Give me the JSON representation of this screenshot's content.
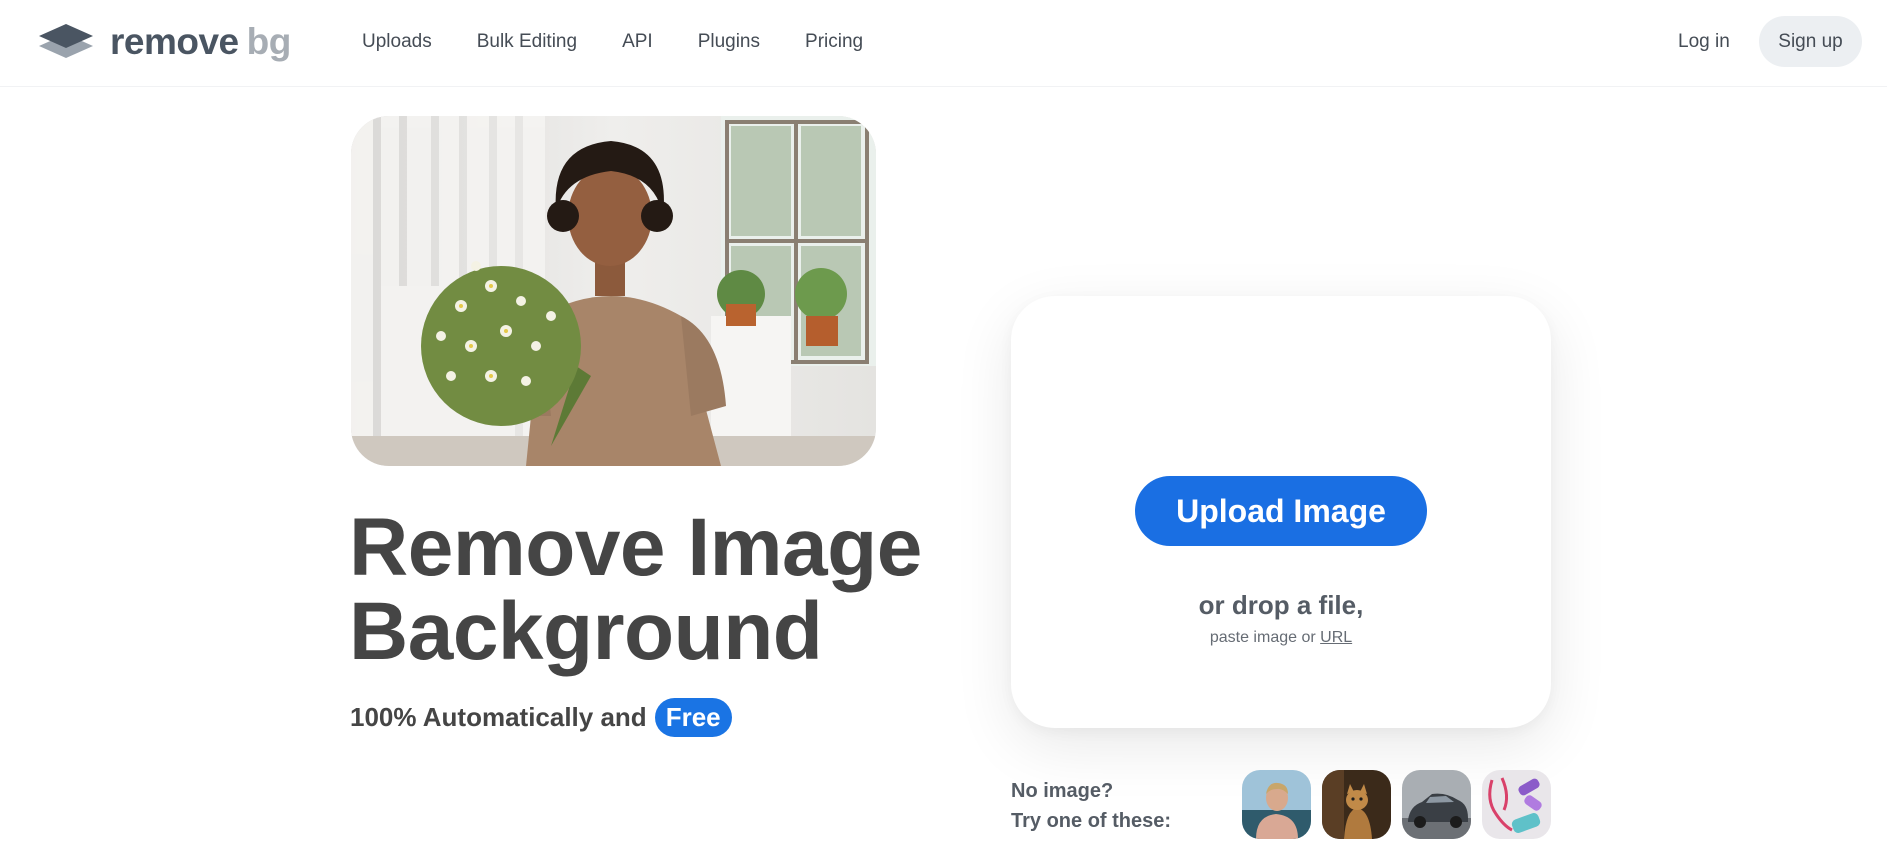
{
  "header": {
    "logo": {
      "word1": "remove",
      "word2": "bg"
    },
    "nav": [
      "Uploads",
      "Bulk Editing",
      "API",
      "Plugins",
      "Pricing"
    ],
    "login": "Log in",
    "signup": "Sign up"
  },
  "hero": {
    "title_line1": "Remove Image",
    "title_line2": "Background",
    "subtitle": "100% Automatically and",
    "badge": "Free"
  },
  "upload": {
    "button": "Upload Image",
    "drop": "or drop a file,",
    "paste_prefix": "paste image or",
    "url": "URL"
  },
  "samples": {
    "line1": "No image?",
    "line2": "Try one of these:",
    "items": [
      "sample-person-icon",
      "sample-cat-icon",
      "sample-car-icon",
      "sample-fitness-icon"
    ]
  },
  "colors": {
    "accent": "#1a6fe3",
    "text": "#454545",
    "signup_bg": "#eceff2"
  }
}
